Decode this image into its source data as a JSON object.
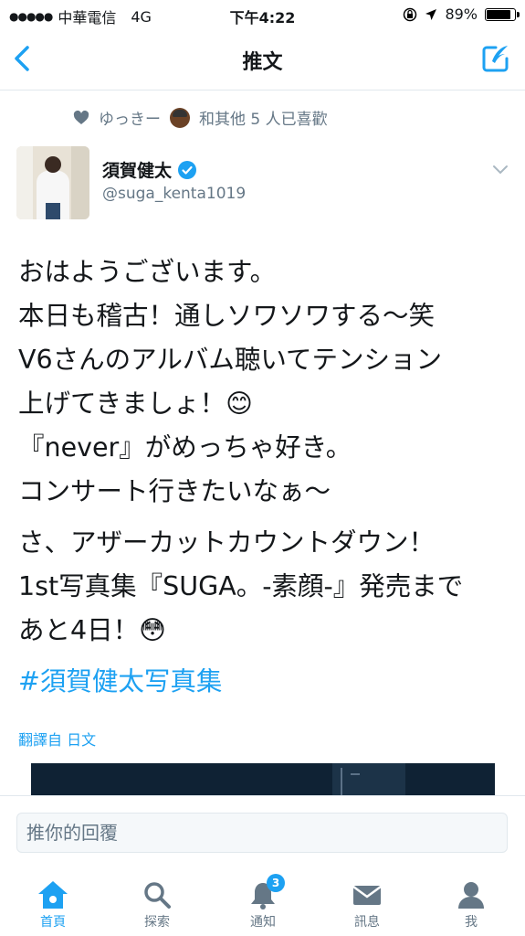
{
  "status_bar": {
    "carrier": "中華電信",
    "network": "4G",
    "time": "下午4:22",
    "battery": "89%",
    "battery_level": 0.89
  },
  "nav": {
    "title": "推文"
  },
  "likes": {
    "first_user": "ゆっきー",
    "rest": "和其他 5 人已喜歡"
  },
  "author": {
    "name": "須賀健太",
    "handle": "@suga_kenta1019"
  },
  "tweet": {
    "para1": "おはようございます。\n本日も稽古！通しソワソワする～笑\nV6さんのアルバム聴いてテンション\n上げてきましょ！😊\n『never』がめっちゃ好き。\nコンサート行きたいなぁ～",
    "para2": "さ、アザーカットカウントダウン！\n1st写真集『SUGA。-素顔-』発売まで\nあと4日！😳",
    "hashtag": "#須賀健太写真集"
  },
  "translate_label": "翻譯自 日文",
  "reply": {
    "placeholder": "推你的回覆"
  },
  "tabs": [
    {
      "label": "首頁",
      "icon": "home-icon"
    },
    {
      "label": "探索",
      "icon": "search-icon"
    },
    {
      "label": "通知",
      "icon": "bell-icon",
      "badge": "3"
    },
    {
      "label": "訊息",
      "icon": "envelope-icon"
    },
    {
      "label": "我",
      "icon": "profile-icon"
    }
  ],
  "colors": {
    "accent": "#1da1f2",
    "text": "#14171a",
    "muted": "#657786"
  }
}
